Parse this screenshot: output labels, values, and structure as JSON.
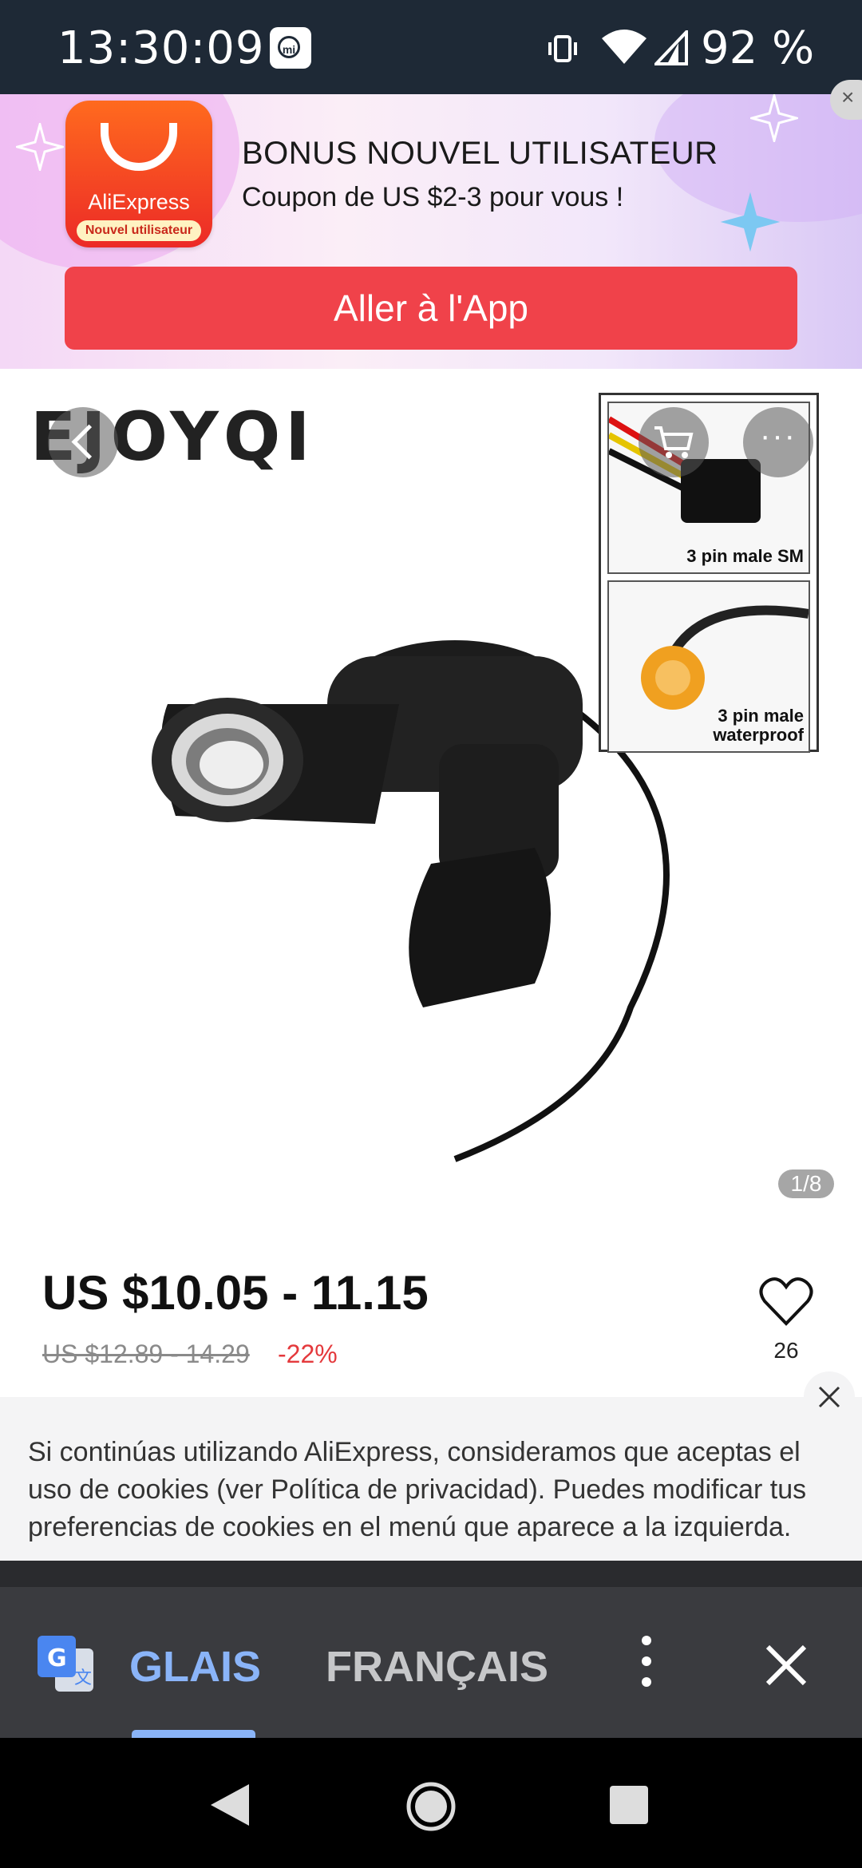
{
  "status_bar": {
    "time": "13:30:09",
    "battery": "92 %",
    "icons": [
      "mi-icon",
      "vibrate-icon",
      "wifi-icon",
      "signal-icon"
    ]
  },
  "promo": {
    "app_brand": "AliExpress",
    "app_tag": "Nouvel utilisateur",
    "title": "BONUS NOUVEL UTILISATEUR",
    "subtitle": "Coupon de US $2-3 pour vous !",
    "cta": "Aller à l'App",
    "close": "×"
  },
  "product_image": {
    "logo": "EJOYQI",
    "inset_top_label": "3 pin male SM",
    "inset_bottom_label": "3 pin male\nwaterproof",
    "counter": "1/8",
    "more": "···"
  },
  "price": {
    "current": "US $10.05 - 11.15",
    "original": "US $12.89 - 14.29",
    "discount": "-22%",
    "wishlist_count": "26"
  },
  "cookie": {
    "text": "Si continúas utilizando AliExpress, consideramos que aceptas el uso de cookies (ver Política de privacidad). Puedes modificar tus preferencias de cookies en el menú que aparece a la izquierda."
  },
  "translate_bar": {
    "source_lang": "GLAIS",
    "target_lang": "FRANÇAIS"
  },
  "colors": {
    "accent": "#f0424a",
    "discount": "#e4393c",
    "translate_active": "#8ab4f8"
  }
}
